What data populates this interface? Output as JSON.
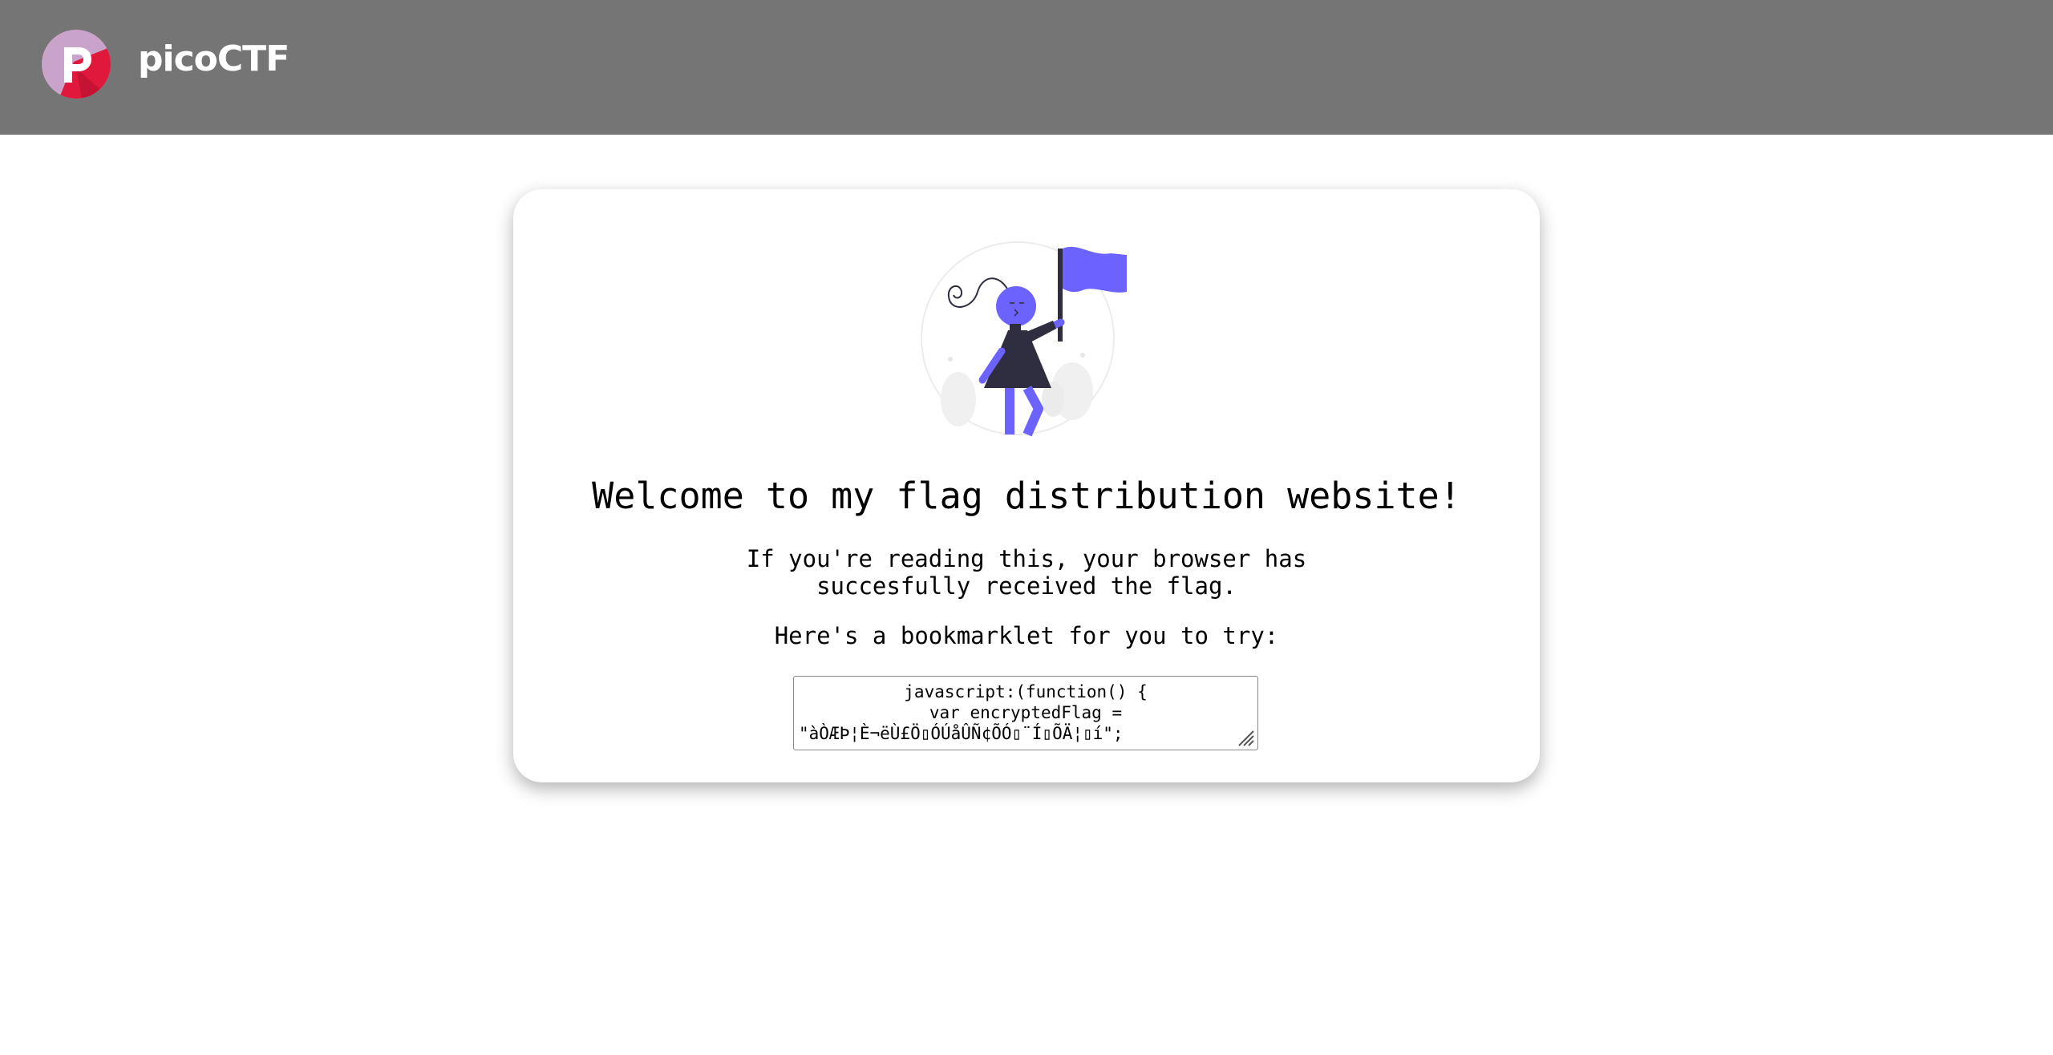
{
  "header": {
    "brand": "picoCTF",
    "logo_letter": "P",
    "background_color": "#757575"
  },
  "card": {
    "title": "Welcome to my flag distribution website!",
    "message_line1": "If you're reading this, your browser has",
    "message_line2": "succesfully received the flag.",
    "bookmarklet_intro": "Here's a bookmarklet for you to try:",
    "bookmarklet_code_line1": "javascript:(function() {",
    "bookmarklet_code_line2": "var encryptedFlag =",
    "bookmarklet_code_line3": "\"àÒÆÞ¦È¬ëÙ£Ö▯ÓÚåÛÑ¢ÕÓ▯¨Í▯ÕÄ¦▯í\";",
    "illustration": {
      "name": "woman-holding-flag",
      "accent_color": "#6c63ff",
      "dark_color": "#2f2e41"
    }
  }
}
